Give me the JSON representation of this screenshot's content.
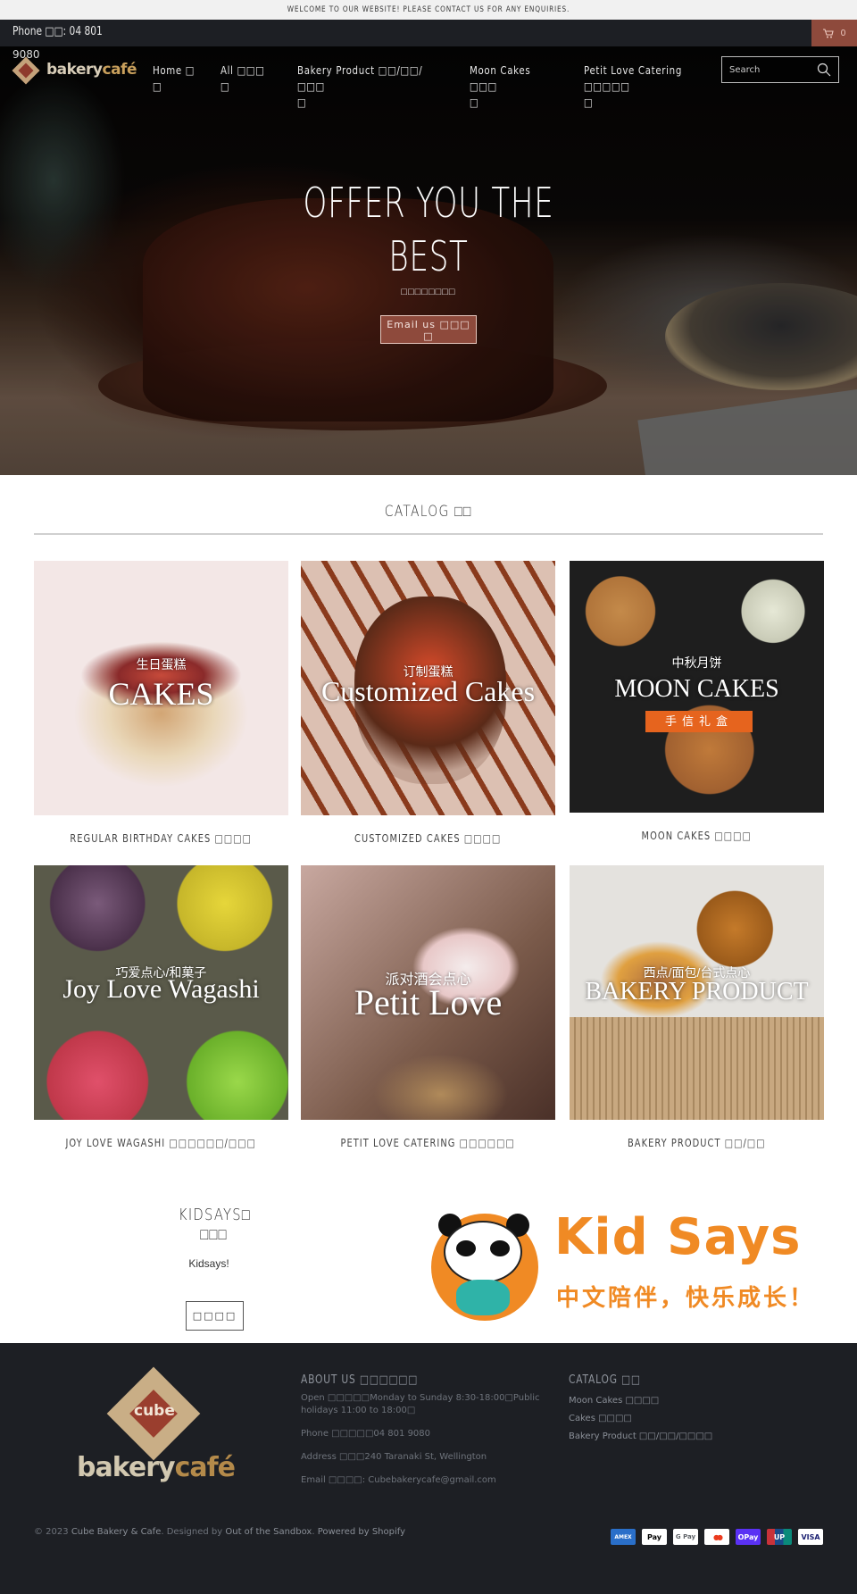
{
  "announcement": "WELCOME TO OUR WEBSITE! PLEASE CONTACT US FOR ANY ENQUIRIES.",
  "topbar": {
    "phone": "Phone □□: 04 801",
    "phone_overflow": "9080",
    "cart_count": "0",
    "cart_icon": "cart-icon"
  },
  "header": {
    "logo_text_a": "bakery",
    "logo_text_b": "café",
    "nav": [
      {
        "label": "Home □",
        "wrap": "□"
      },
      {
        "label": "All □□□",
        "wrap": "□"
      },
      {
        "label": "Bakery Product □□/□□/□□□",
        "wrap": "□"
      },
      {
        "label": "Moon Cakes □□□",
        "wrap": "□"
      },
      {
        "label": "Petit Love Catering □□□□□",
        "wrap": "□"
      }
    ],
    "search_placeholder": "Search",
    "search_icon": "search-icon"
  },
  "hero": {
    "title": "OFFER YOU THE BEST",
    "subtitle": "□□□□□□□□",
    "button_label": "Email us □□□",
    "button_wrap": "□"
  },
  "catalog": {
    "title": "CATALOG □□",
    "cards": [
      {
        "overlay_cn": "生日蛋糕",
        "overlay_en": "CAKES",
        "label": "REGULAR BIRTHDAY CAKES □□□□"
      },
      {
        "overlay_cn": "订制蛋糕",
        "overlay_en": "Customized Cakes",
        "label": "CUSTOMIZED CAKES □□□□"
      },
      {
        "overlay_cn": "中秋月饼",
        "overlay_en": "MOON CAKES",
        "overlay_badge": "手信礼盒",
        "label": "MOON CAKES □□□□"
      },
      {
        "overlay_cn": "巧爱点心/和菓子",
        "overlay_en": "Joy Love Wagashi",
        "label": "JOY LOVE WAGASHI □□□□□□/□□□"
      },
      {
        "overlay_cn": "派对酒会点心",
        "overlay_en": "Petit Love",
        "label": "PETIT LOVE CATERING □□□□□□"
      },
      {
        "overlay_cn": "西点/面包/台式点心",
        "overlay_en": "BAKERY PRODUCT",
        "label": "BAKERY PRODUCT □□/□□"
      }
    ]
  },
  "kidsays": {
    "title_line1": "KIDSAYS□",
    "title_line2": "□□□",
    "text": "Kidsays!",
    "button_label": "□□□□",
    "logo_word": "Kid Says",
    "logo_slogan": "中文陪伴，快乐成长！",
    "brand_color": "#f08a24"
  },
  "footer": {
    "logo_cube": "cube",
    "logo_text_a": "bakery",
    "logo_text_b": "café",
    "about": {
      "heading": "ABOUT US □□□□□□",
      "open": "Open □□□□□Monday to Sunday 8:30-18:00□Public holidays 11:00 to 18:00□",
      "phone": "Phone □□□□□04 801 9080",
      "address": "Address □□□240 Taranaki St, Wellington",
      "email": "Email □□□□: Cubebakerycafe@gmail.com"
    },
    "catalog": {
      "heading": "CATALOG □□",
      "links": [
        "Moon Cakes □□□□",
        "Cakes □□□□",
        "Bakery Product □□/□□/□□□□"
      ]
    },
    "copyright_prefix": "© 2023 ",
    "copyright_brand": "Cube Bakery & Cafe",
    "copyright_mid": ". Designed by ",
    "copyright_designer": "Out of the Sandbox",
    "copyright_sep": ". ",
    "copyright_powered": "Powered by Shopify",
    "payments": [
      {
        "name": "amex",
        "label": "AMEX",
        "bg": "#2a6fc9",
        "fg": "#ffffff"
      },
      {
        "name": "apple-pay",
        "label": "Pay",
        "bg": "#ffffff",
        "fg": "#000000"
      },
      {
        "name": "google-pay",
        "label": "G Pay",
        "bg": "#ffffff",
        "fg": "#5f6368"
      },
      {
        "name": "mastercard",
        "label": "●●",
        "bg": "#ffffff",
        "fg": "#eb3b1e"
      },
      {
        "name": "o-pay",
        "label": "OPay",
        "bg": "#5a31f4",
        "fg": "#ffffff"
      },
      {
        "name": "unionpay",
        "label": "UP",
        "bg": "#c8323a",
        "fg": "#ffffff"
      },
      {
        "name": "visa",
        "label": "VISA",
        "bg": "#ffffff",
        "fg": "#1a1f71"
      }
    ]
  },
  "colors": {
    "accent": "#8e4a3c",
    "dark_bg": "#1d1f24",
    "announce_bg": "#f1f1f1"
  }
}
